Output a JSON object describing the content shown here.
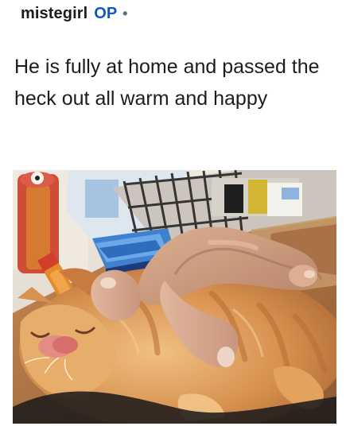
{
  "comment": {
    "username": "mistegirl",
    "op_badge": "OP",
    "separator": "•",
    "body": "He is fully at home and passed the heck out all warm and happy"
  },
  "media": {
    "icon": "kitten-photo",
    "colors": {
      "kitten_fur": "#d8914f",
      "background_wall": "#e7e0d7",
      "floor_wood": "#b77a45",
      "can_red": "#c84a35",
      "box_blue": "#3c7fcf"
    }
  }
}
